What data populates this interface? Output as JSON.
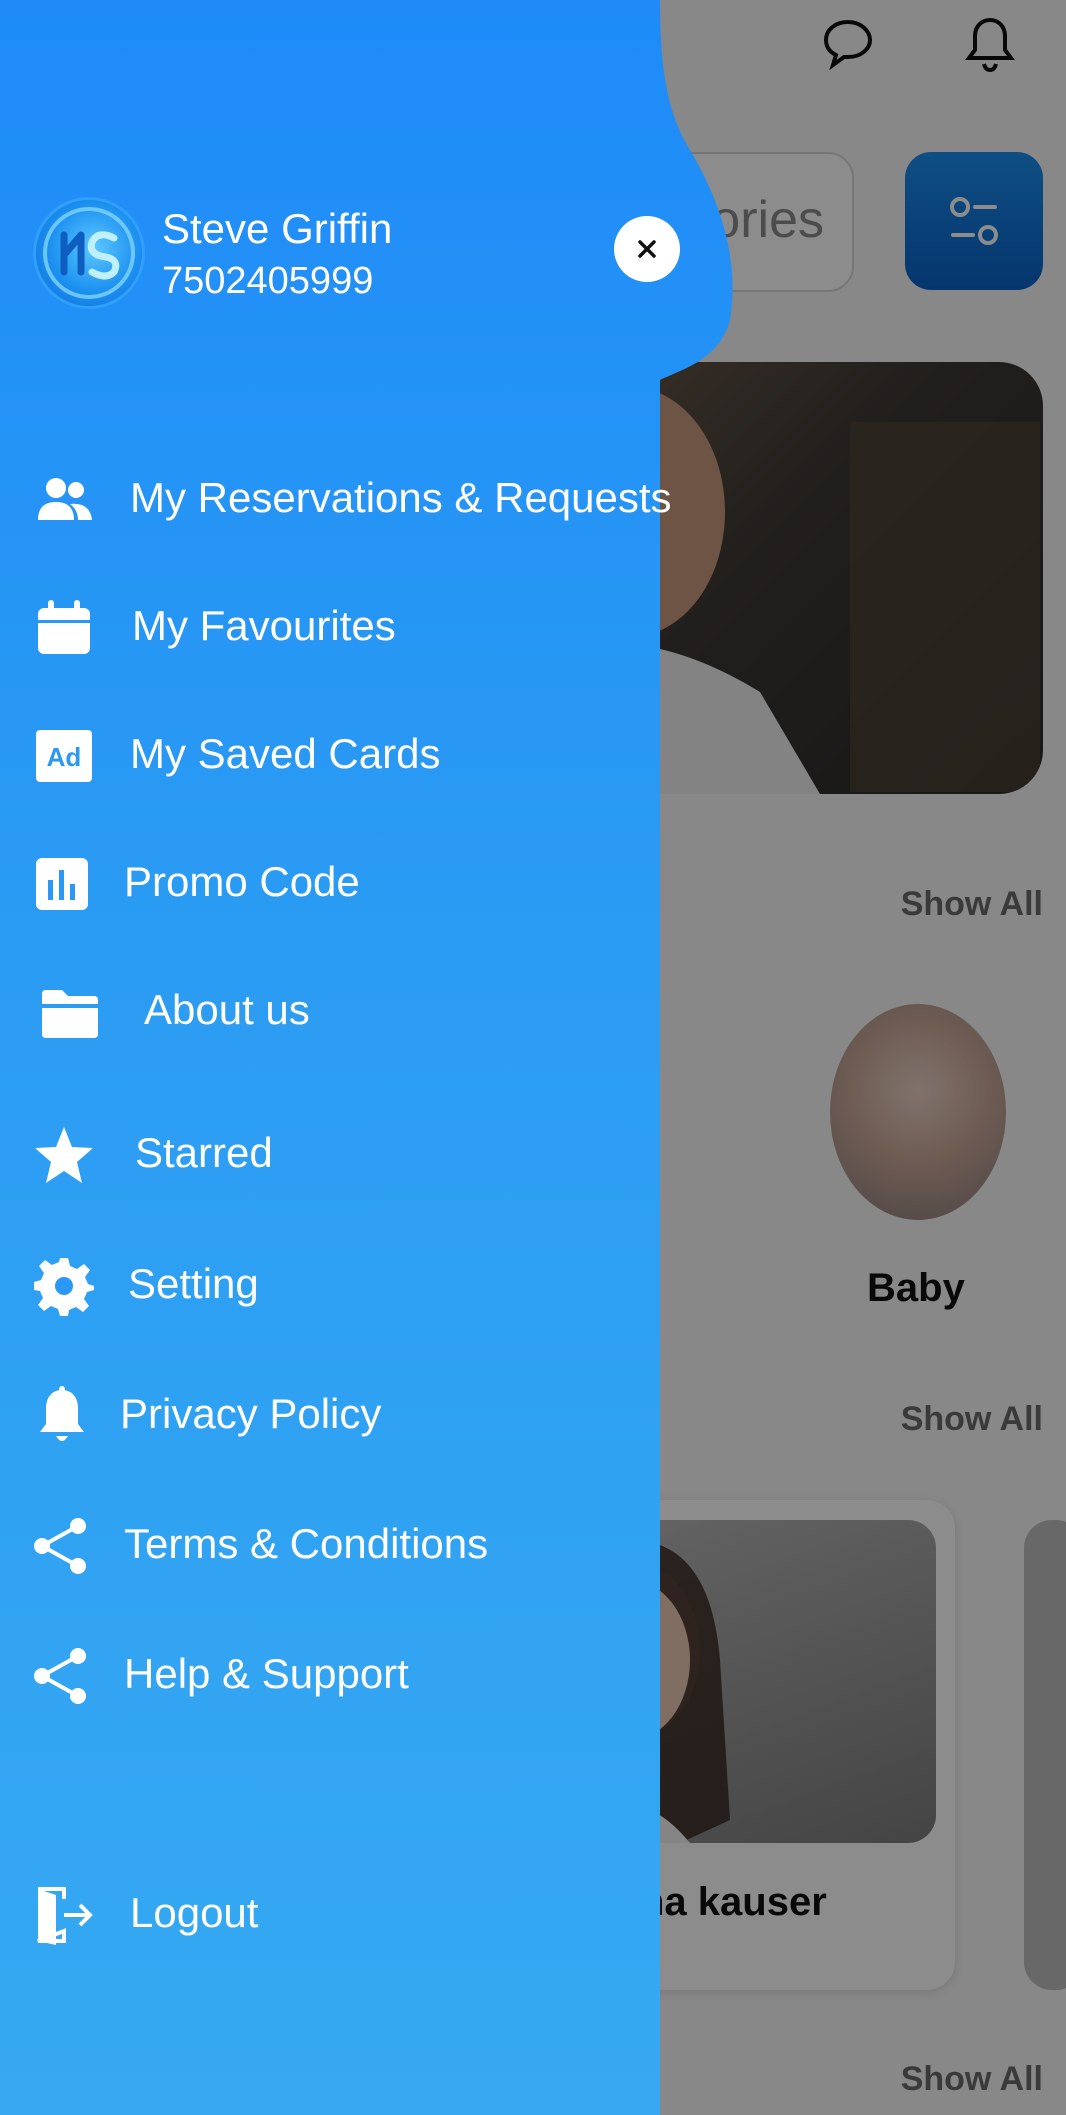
{
  "drawer": {
    "user": {
      "name": "Steve Griffin",
      "phone": "7502405999",
      "avatar_icon": "app-logo-icon"
    },
    "close_icon": "close-icon",
    "menu": [
      {
        "label": "My Reservations & Requests",
        "icon": "users-icon"
      },
      {
        "label": "My Favourites",
        "icon": "calendar-icon"
      },
      {
        "label": "My Saved Cards",
        "icon": "ad-icon"
      },
      {
        "label": "Promo Code",
        "icon": "bar-chart-icon"
      },
      {
        "label": "About us",
        "icon": "folder-icon"
      },
      {
        "label": "Starred",
        "icon": "star-icon"
      },
      {
        "label": "Setting",
        "icon": "gear-icon"
      },
      {
        "label": "Privacy Policy",
        "icon": "bell-icon"
      },
      {
        "label": "Terms & Conditions",
        "icon": "share-icon"
      },
      {
        "label": "Help & Support",
        "icon": "share-icon"
      }
    ],
    "logout": {
      "label": "Logout",
      "icon": "logout-icon"
    },
    "colors": {
      "gradient_top": "#1e8bf8",
      "gradient_bottom": "#36a9f2"
    }
  },
  "background": {
    "search_placeholder_visible": "ories",
    "show_all_label": "Show All",
    "category_label": "Baby",
    "provider_name_visible": "na kauser",
    "header_icons": [
      "chat-icon",
      "bell-icon"
    ],
    "filter_icon": "filter-icon",
    "accent_color": "#0a63c8"
  }
}
